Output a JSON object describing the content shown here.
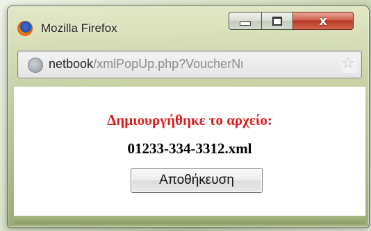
{
  "window": {
    "title": "Mozilla Firefox",
    "buttons": {
      "minimize_icon": "minimize-icon",
      "maximize_icon": "maximize-icon",
      "close_label": "x"
    }
  },
  "urlbar": {
    "host": "netbook",
    "path": "/xmlPopUp.php?VoucherNι",
    "site_icon": "globe-icon",
    "bookmark_icon": "star-icon"
  },
  "content": {
    "message": "Δημιουργήθηκε το αρχείο:",
    "filename": "01233-334-3312.xml",
    "save_button_label": "Αποθήκευση"
  },
  "colors": {
    "message_color": "#e01b1b",
    "filename_color": "#000000",
    "close_button": "#c9442f"
  }
}
